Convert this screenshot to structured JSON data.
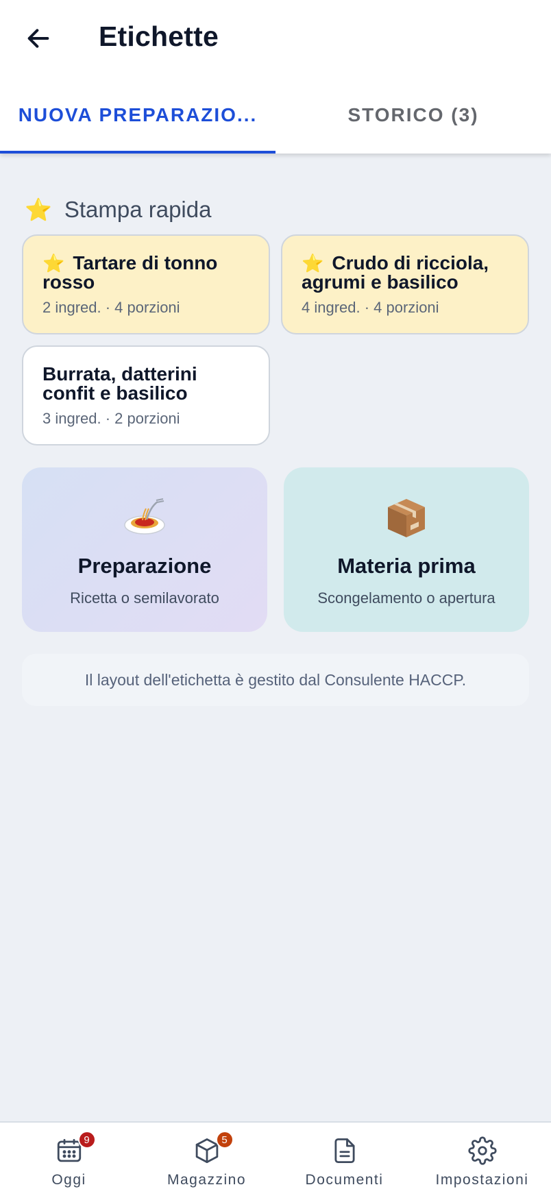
{
  "header": {
    "title": "Etichette",
    "back_icon": "arrow-left-icon"
  },
  "tabs": [
    {
      "label": "NUOVA PREPARAZIO...",
      "active": true
    },
    {
      "label": "STORICO (3)",
      "active": false
    }
  ],
  "quick_print": {
    "title": "Stampa rapida",
    "icon": "⭐",
    "items": [
      {
        "name": "Tartare di tonno rosso",
        "meta": "2 ingred. · 4 porzioni",
        "favorite": true
      },
      {
        "name": "Crudo di ricciola, agrumi e basilico",
        "meta": "4 ingred. · 4 porzioni",
        "favorite": true
      },
      {
        "name": "Burrata, datterini confit e basilico",
        "meta": "3 ingred. · 2 porzioni",
        "favorite": false
      }
    ]
  },
  "actions": [
    {
      "title": "Preparazione",
      "subtitle": "Ricetta o semilavorato",
      "icon": "spaghetti-icon"
    },
    {
      "title": "Materia prima",
      "subtitle": "Scongelamento o apertura",
      "icon": "package-icon"
    }
  ],
  "info_note": "Il layout dell'etichetta è gestito dal Consulente HACCP.",
  "bottom_nav": [
    {
      "label": "Oggi",
      "icon": "calendar-icon",
      "badge": "9",
      "badge_color": "#b91c1c"
    },
    {
      "label": "Magazzino",
      "icon": "box-icon",
      "badge": "5",
      "badge_color": "#c2410c"
    },
    {
      "label": "Documenti",
      "icon": "document-icon",
      "badge": null
    },
    {
      "label": "Impostazioni",
      "icon": "gear-icon",
      "badge": null
    }
  ],
  "colors": {
    "accent": "#1d4ed8",
    "background": "#edf0f5",
    "favorite_card": "#fdf1c7"
  }
}
